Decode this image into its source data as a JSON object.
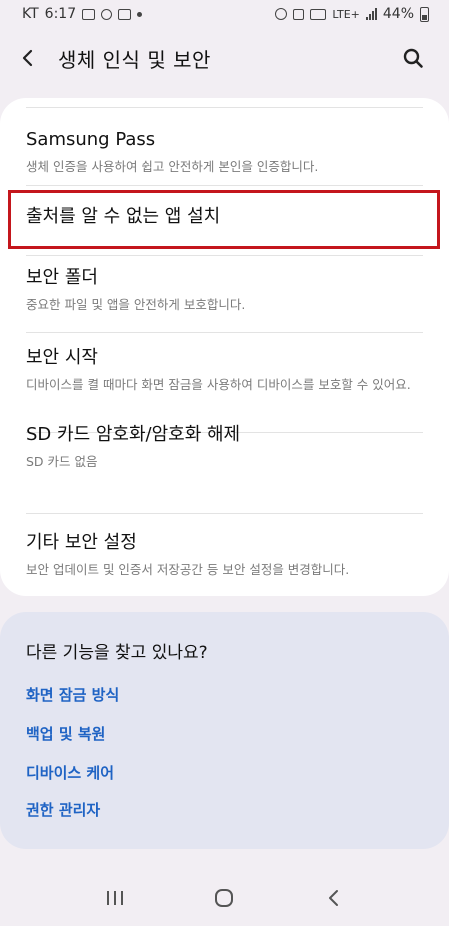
{
  "status_bar": {
    "carrier": "KT",
    "time": "6:17",
    "network": "LTE+",
    "battery": "44%"
  },
  "header": {
    "title": "생체 인식 및 보안"
  },
  "menu": [
    {
      "title": "Samsung Pass",
      "subtitle": "생체 인증을 사용하여 쉽고 안전하게 본인을 인증합니다."
    },
    {
      "title": "출처를 알 수 없는 앱 설치",
      "subtitle": ""
    },
    {
      "title": "보안 폴더",
      "subtitle": "중요한 파일 및 앱을 안전하게 보호합니다."
    },
    {
      "title": "보안 시작",
      "subtitle": "디바이스를 켤 때마다 화면 잠금을 사용하여 디바이스를 보호할 수 있어요."
    },
    {
      "title": "SD 카드 암호화/암호화 해제",
      "subtitle": "SD 카드 없음"
    },
    {
      "title": "기타 보안 설정",
      "subtitle": "보안 업데이트 및 인증서 저장공간 등 보안 설정을 변경합니다."
    }
  ],
  "suggestions": {
    "title": "다른 기능을 찾고 있나요?",
    "links": [
      "화면 잠금 방식",
      "백업 및 복원",
      "디바이스 케어",
      "권한 관리자"
    ]
  },
  "colors": {
    "background": "#f2eef3",
    "card": "#ffffff",
    "suggest_card": "#e3e5f1",
    "link": "#1f63c4",
    "highlight": "#c4161c"
  },
  "icons": {
    "back": "chevron-left-icon",
    "search": "search-icon",
    "nav_recents": "recents-icon",
    "nav_home": "home-icon",
    "nav_back": "back-icon"
  }
}
